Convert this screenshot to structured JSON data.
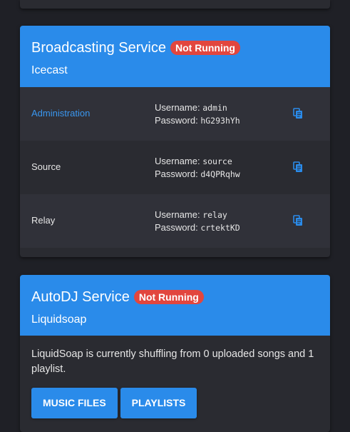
{
  "broadcast": {
    "title": "Broadcasting Service",
    "status": "Not Running",
    "subtitle": "Icecast",
    "credentials": [
      {
        "label": "Administration",
        "username_label": "Username:",
        "username": "admin",
        "password_label": "Password:",
        "password": "hG293hYh"
      },
      {
        "label": "Source",
        "username_label": "Username:",
        "username": "source",
        "password_label": "Password:",
        "password": "d4QPRqhw"
      },
      {
        "label": "Relay",
        "username_label": "Username:",
        "username": "relay",
        "password_label": "Password:",
        "password": "crtektKD"
      }
    ]
  },
  "autodj": {
    "title": "AutoDJ Service",
    "status": "Not Running",
    "subtitle": "Liquidsoap",
    "description": "LiquidSoap is currently shuffling from 0 uploaded songs and 1 playlist.",
    "buttons": {
      "music_files": "MUSIC FILES",
      "playlists": "PLAYLISTS"
    }
  },
  "icons": {
    "copy": "copy-icon"
  },
  "colors": {
    "accent": "#2a8bea",
    "badge": "#e2463e",
    "link": "#3a97f0",
    "background": "#1f2026",
    "card": "#2a2b31"
  }
}
